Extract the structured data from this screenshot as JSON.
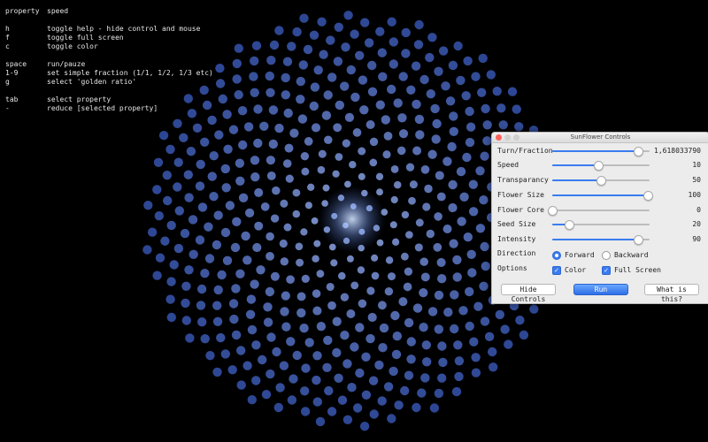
{
  "help": {
    "rows": [
      {
        "key": "property",
        "desc": "speed"
      },
      {
        "key": "h",
        "desc": "toggle help - hide control and mouse"
      },
      {
        "key": "f",
        "desc": "toggle full screen"
      },
      {
        "key": "c",
        "desc": "toggle color"
      },
      {
        "key": "space",
        "desc": "run/pauze"
      },
      {
        "key": "1-9",
        "desc": "set simple fraction (1/1, 1/2, 1/3 etc)"
      },
      {
        "key": "g",
        "desc": "select 'golden ratio'"
      },
      {
        "key": "tab",
        "desc": "select property"
      },
      {
        "key": "-",
        "desc": "reduce [selected property]"
      }
    ]
  },
  "window": {
    "title": "SunFlower Controls"
  },
  "controls": [
    {
      "label": "Turn/Fraction",
      "value": "1,618033790",
      "level": 0.88
    },
    {
      "label": "Speed",
      "value": "10",
      "level": 0.47
    },
    {
      "label": "Transparancy",
      "value": "50",
      "level": 0.5
    },
    {
      "label": "Flower Size",
      "value": "100",
      "level": 0.98
    },
    {
      "label": "Flower Core",
      "value": "0",
      "level": 0.0
    },
    {
      "label": "Seed Size",
      "value": "20",
      "level": 0.17
    },
    {
      "label": "Intensity",
      "value": "90",
      "level": 0.88
    }
  ],
  "direction": {
    "label": "Direction",
    "forward": "Forward",
    "backward": "Backward",
    "selected": "forward"
  },
  "options": {
    "label": "Options",
    "color": "Color",
    "full_screen": "Full Screen"
  },
  "buttons": {
    "hide": "Hide Controls",
    "run": "Run",
    "what": "What is this?"
  },
  "colors": {
    "seed_center": "#b9d2ff",
    "seed_outer": "#2b4aa8",
    "accent": "#3a7cf0",
    "background": "#000000"
  }
}
